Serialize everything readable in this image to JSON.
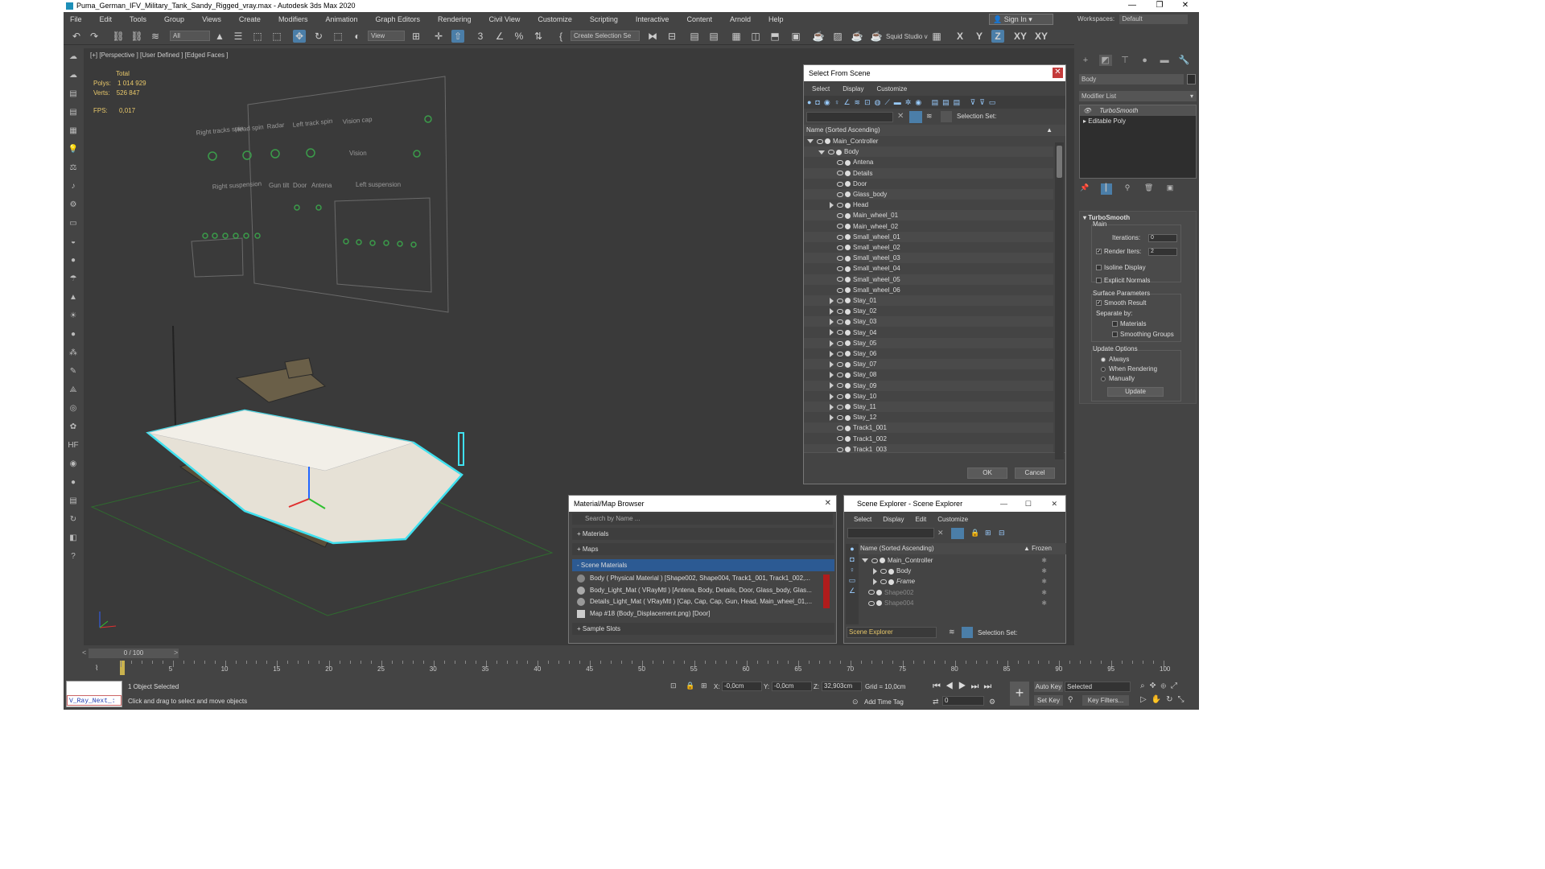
{
  "titlebar": {
    "title": "Puma_German_IFV_Military_Tank_Sandy_Rigged_vray.max - Autodesk 3ds Max 2020"
  },
  "menu": [
    "File",
    "Edit",
    "Tools",
    "Group",
    "Views",
    "Create",
    "Modifiers",
    "Animation",
    "Graph Editors",
    "Rendering",
    "Civil View",
    "Customize",
    "Scripting",
    "Interactive",
    "Content",
    "Arnold",
    "Help"
  ],
  "signin": "Sign In",
  "workspaces": {
    "label": "Workspaces:",
    "value": "Default"
  },
  "toolbar": {
    "filter": "All",
    "refcoord": "View",
    "selset": "Create Selection Se",
    "squid": "Squid Studio v",
    "axes": [
      "X",
      "Y",
      "Z",
      "XY",
      "XY"
    ]
  },
  "viewport": {
    "label": "[+] [Perspective ] [User Defined ] [Edged Faces ]",
    "stats": {
      "total": "Total",
      "polys_label": "Polys:",
      "polys": "1 014 929",
      "verts_label": "Verts:",
      "verts": "526 847",
      "fps_label": "FPS:",
      "fps": "0,017"
    },
    "rig_labels": [
      "Right tracks spin",
      "Head spin",
      "Radar",
      "Left track spin",
      "Vision cap",
      "Vision",
      "Right suspension",
      "Gun tilt",
      "Door",
      "Antena",
      "Left suspension"
    ]
  },
  "select_dialog": {
    "title": "Select From Scene",
    "menu": [
      "Select",
      "Display",
      "Customize"
    ],
    "selection_set": "Selection Set:",
    "column": "Name (Sorted Ascending)",
    "rows": [
      {
        "name": "Main_Controller",
        "level": 0,
        "exp": "open"
      },
      {
        "name": "Body",
        "level": 1,
        "exp": "open"
      },
      {
        "name": "Antena",
        "level": 2,
        "exp": ""
      },
      {
        "name": "Details",
        "level": 2,
        "exp": ""
      },
      {
        "name": "Door",
        "level": 2,
        "exp": ""
      },
      {
        "name": "Glass_body",
        "level": 2,
        "exp": ""
      },
      {
        "name": "Head",
        "level": 2,
        "exp": "closed"
      },
      {
        "name": "Main_wheel_01",
        "level": 2,
        "exp": ""
      },
      {
        "name": "Main_wheel_02",
        "level": 2,
        "exp": ""
      },
      {
        "name": "Small_wheel_01",
        "level": 2,
        "exp": ""
      },
      {
        "name": "Small_wheel_02",
        "level": 2,
        "exp": ""
      },
      {
        "name": "Small_wheel_03",
        "level": 2,
        "exp": ""
      },
      {
        "name": "Small_wheel_04",
        "level": 2,
        "exp": ""
      },
      {
        "name": "Small_wheel_05",
        "level": 2,
        "exp": ""
      },
      {
        "name": "Small_wheel_06",
        "level": 2,
        "exp": ""
      },
      {
        "name": "Stay_01",
        "level": 2,
        "exp": "closed"
      },
      {
        "name": "Stay_02",
        "level": 2,
        "exp": "closed"
      },
      {
        "name": "Stay_03",
        "level": 2,
        "exp": "closed"
      },
      {
        "name": "Stay_04",
        "level": 2,
        "exp": "closed"
      },
      {
        "name": "Stay_05",
        "level": 2,
        "exp": "closed"
      },
      {
        "name": "Stay_06",
        "level": 2,
        "exp": "closed"
      },
      {
        "name": "Stay_07",
        "level": 2,
        "exp": "closed"
      },
      {
        "name": "Stay_08",
        "level": 2,
        "exp": "closed"
      },
      {
        "name": "Stay_09",
        "level": 2,
        "exp": "closed"
      },
      {
        "name": "Stay_10",
        "level": 2,
        "exp": "closed"
      },
      {
        "name": "Stay_11",
        "level": 2,
        "exp": "closed"
      },
      {
        "name": "Stay_12",
        "level": 2,
        "exp": "closed"
      },
      {
        "name": "Track1_001",
        "level": 2,
        "exp": ""
      },
      {
        "name": "Track1_002",
        "level": 2,
        "exp": ""
      },
      {
        "name": "Track1_003",
        "level": 2,
        "exp": ""
      }
    ],
    "ok": "OK",
    "cancel": "Cancel"
  },
  "material_browser": {
    "title": "Material/Map Browser",
    "search": "Search by Name ...",
    "sections": [
      "+ Materials",
      "+ Maps",
      "- Scene Materials",
      "+ Sample Slots"
    ],
    "materials": [
      "Body  ( Physical Material )  [Shape002, Shape004, Track1_001, Track1_002,...",
      "Body_Light_Mat  ( VRayMtl )  [Antena, Body, Details, Door, Glass_body, Glas...",
      "Details_Light_Mat  ( VRayMtl )  [Cap, Cap, Cap, Gun, Head, Main_wheel_01,...",
      "Map #18 (Body_Displacement.png)  [Door]"
    ]
  },
  "scene_explorer": {
    "title": "Scene Explorer - Scene Explorer",
    "menu": [
      "Select",
      "Display",
      "Edit",
      "Customize"
    ],
    "column": "Name (Sorted Ascending)",
    "frozen": "▲ Frozen",
    "rows": [
      "Main_Controller",
      "Body",
      "Frame",
      "Shape002",
      "Shape004"
    ],
    "footer_dropdown": "Scene Explorer",
    "selection_set": "Selection Set:"
  },
  "command_panel": {
    "name": "Body",
    "modifier_list": "Modifier List",
    "stack": [
      "TurboSmooth",
      "Editable Poly"
    ],
    "turbosmooth": {
      "title": "TurboSmooth",
      "main": "Main",
      "iterations_label": "Iterations:",
      "iterations": "0",
      "render_iters_label": "Render Iters:",
      "render_iters": "2",
      "isoline": "Isoline Display",
      "explicit": "Explicit Normals",
      "surface": "Surface Parameters",
      "smooth_result": "Smooth Result",
      "separate_by": "Separate by:",
      "materials": "Materials",
      "smoothing_groups": "Smoothing Groups",
      "update_options": "Update Options",
      "always": "Always",
      "when_rendering": "When Rendering",
      "manually": "Manually",
      "update": "Update"
    }
  },
  "timeline": {
    "frame": "0 / 100",
    "ticks": [
      "5",
      "10",
      "15",
      "20",
      "25",
      "30",
      "35",
      "40",
      "45",
      "50",
      "55",
      "60",
      "65",
      "70",
      "75",
      "80",
      "85",
      "90",
      "95",
      "100"
    ]
  },
  "status": {
    "script": "V_Ray_Next_:",
    "selected": "1 Object Selected",
    "hint": "Click and drag to select and move objects",
    "x_label": "X:",
    "x": "-0,0cm",
    "y_label": "Y:",
    "y": "-0,0cm",
    "z_label": "Z:",
    "z": "32,903cm",
    "grid": "Grid = 10,0cm",
    "add_time_tag": "Add Time Tag",
    "auto_key": "Auto Key",
    "selected_dd": "Selected",
    "set_key": "Set Key",
    "key_filters": "Key Filters...",
    "frame_field": "0"
  }
}
